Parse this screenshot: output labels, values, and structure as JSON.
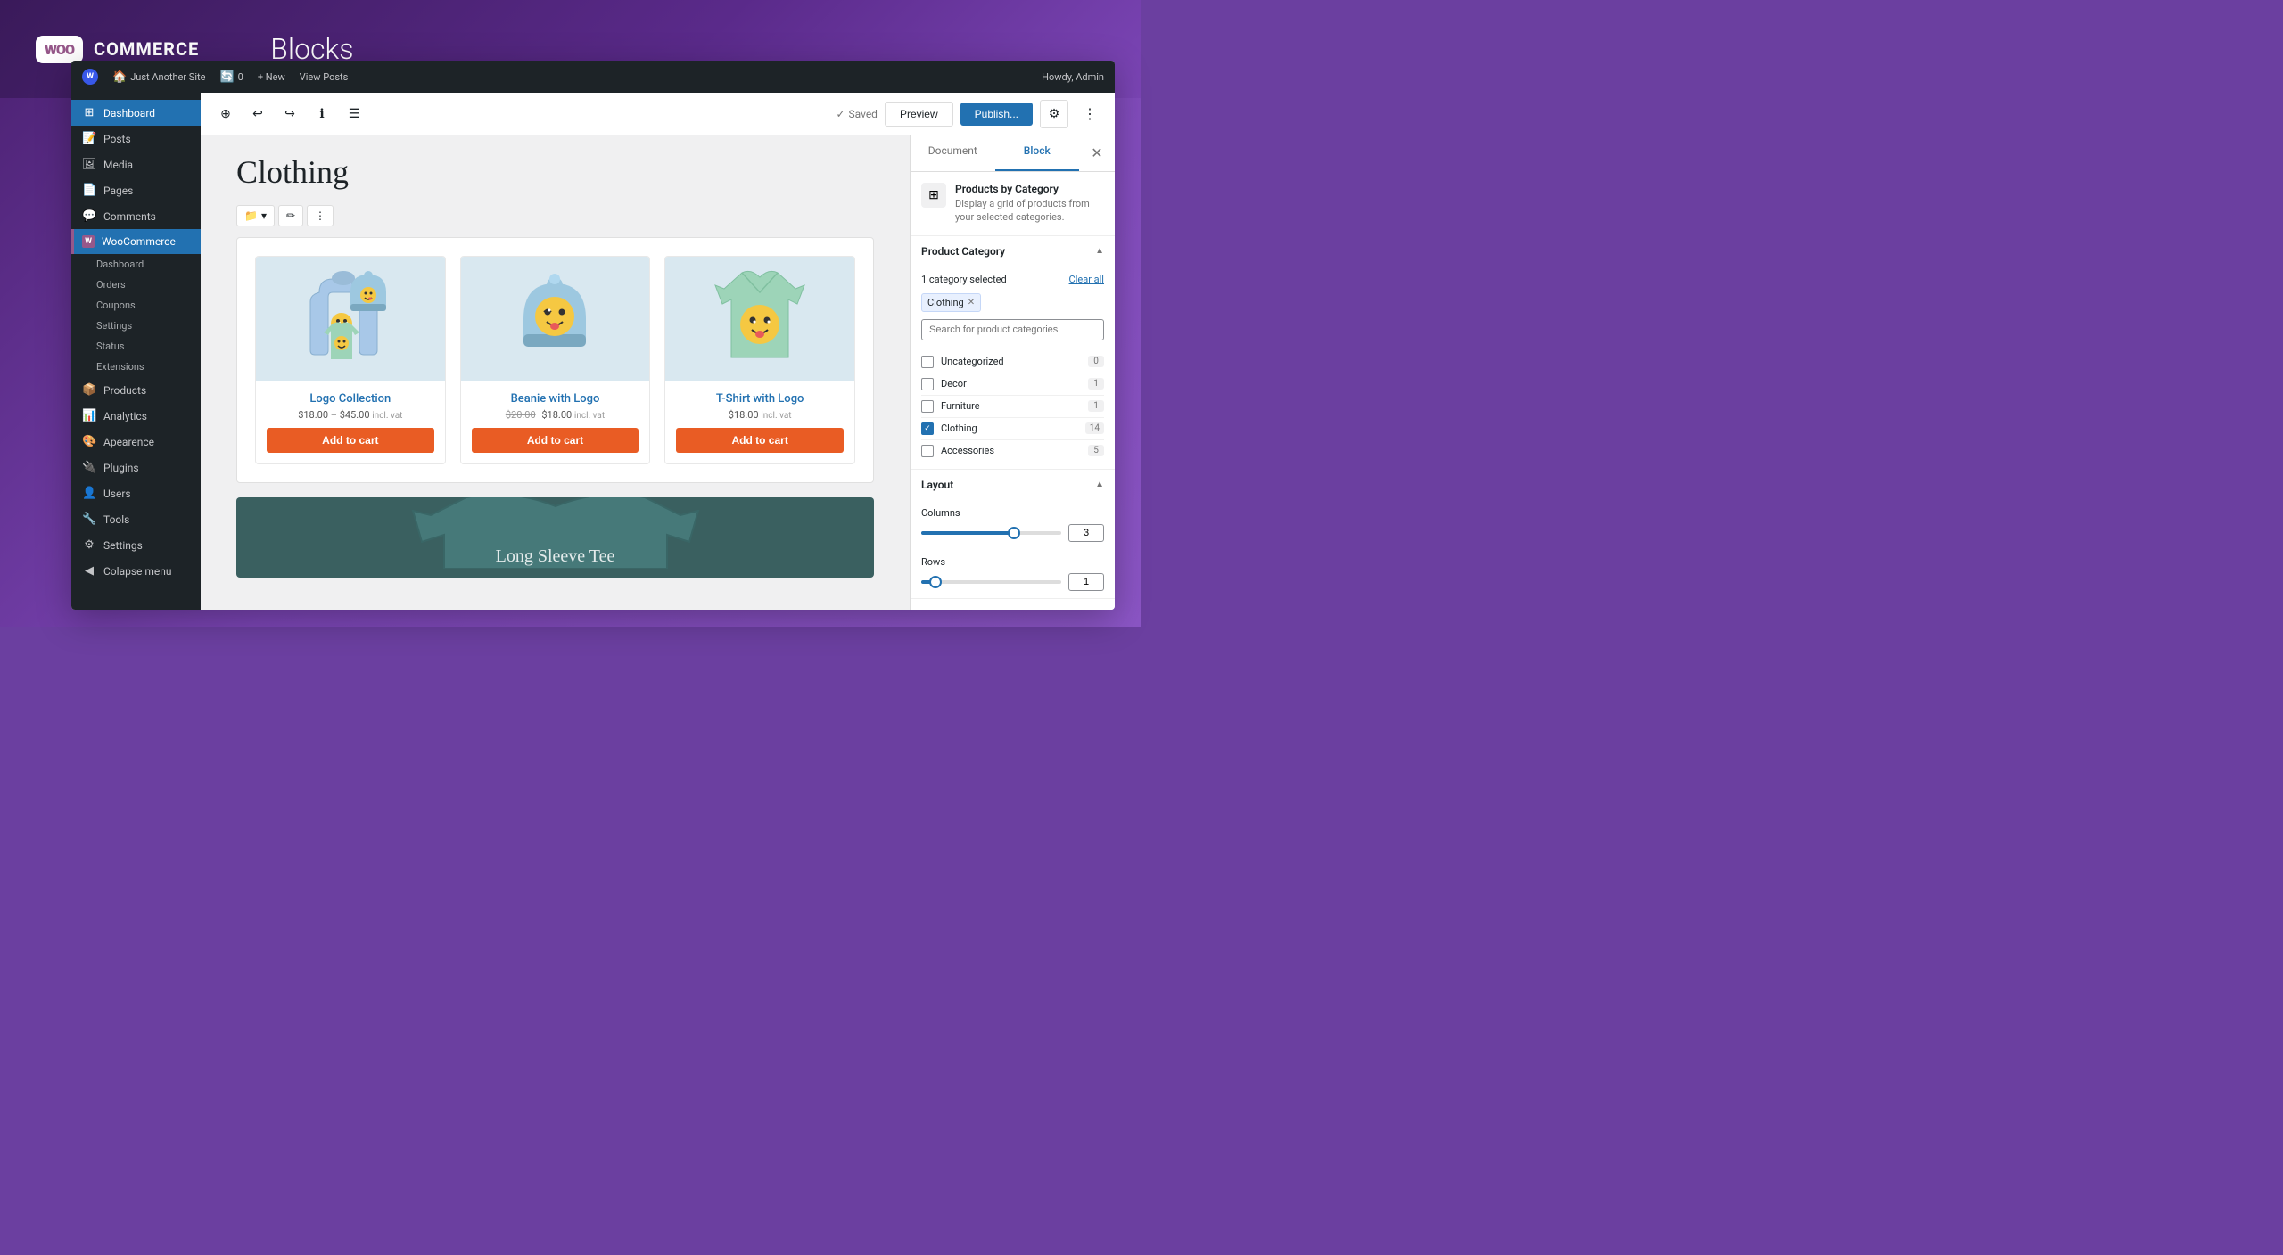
{
  "header": {
    "logo_text": "WOO",
    "logo_emphasis": "COMMERCE",
    "title": "Blocks"
  },
  "admin_bar": {
    "site_name": "Just Another Site",
    "updates_count": "0",
    "new_label": "+ New",
    "view_posts_label": "View Posts",
    "howdy_label": "Howdy, Admin"
  },
  "toolbar": {
    "saved_label": "Saved",
    "preview_label": "Preview",
    "publish_label": "Publish..."
  },
  "sidebar": {
    "items": [
      {
        "label": "Dashboard",
        "icon": "⊞",
        "active": true
      },
      {
        "label": "Posts",
        "icon": "📝",
        "active": false
      },
      {
        "label": "Media",
        "icon": "🖼",
        "active": false
      },
      {
        "label": "Pages",
        "icon": "📄",
        "active": false
      },
      {
        "label": "Comments",
        "icon": "💬",
        "active": false
      },
      {
        "label": "WooCommerce",
        "icon": "W",
        "active": true,
        "woo": true
      },
      {
        "label": "Dashboard",
        "sub": true
      },
      {
        "label": "Orders",
        "sub": true
      },
      {
        "label": "Coupons",
        "sub": true
      },
      {
        "label": "Settings",
        "sub": true
      },
      {
        "label": "Status",
        "sub": true
      },
      {
        "label": "Extensions",
        "sub": true
      },
      {
        "label": "Products",
        "icon": "📦",
        "active": false
      },
      {
        "label": "Analytics",
        "icon": "📊",
        "active": false
      },
      {
        "label": "Appearance",
        "icon": "🎨",
        "active": false
      },
      {
        "label": "Plugins",
        "icon": "🔌",
        "active": false
      },
      {
        "label": "Users",
        "icon": "👤",
        "active": false
      },
      {
        "label": "Tools",
        "icon": "🔧",
        "active": false
      },
      {
        "label": "Settings",
        "icon": "⚙",
        "active": false
      }
    ],
    "collapse_label": "Collapse menu"
  },
  "editor": {
    "page_title": "Clothing",
    "block_toolbar": {
      "folder_btn": "📁",
      "edit_btn": "✏",
      "more_btn": "⋮"
    }
  },
  "products": [
    {
      "name": "Logo Collection",
      "price_from": "$18.00",
      "price_to": "$45.00",
      "price_note": "incl. vat",
      "add_to_cart": "Add to cart"
    },
    {
      "name": "Beanie with Logo",
      "price_original": "$20.00",
      "price_sale": "$18.00",
      "price_note": "incl. vat",
      "add_to_cart": "Add to cart"
    },
    {
      "name": "T-Shirt with Logo",
      "price": "$18.00",
      "price_note": "incl. vat",
      "add_to_cart": "Add to cart"
    }
  ],
  "second_block_preview_label": "Long Sleeve Tee",
  "right_panel": {
    "tab_document": "Document",
    "tab_block": "Block",
    "block_info": {
      "title": "Products by Category",
      "description": "Display a grid of products from your selected categories."
    },
    "product_category_section": {
      "title": "Product Category",
      "selected_count": "1 category selected",
      "clear_label": "Clear all",
      "selected_tag": "Clothing",
      "search_placeholder": "Search for product categories"
    },
    "categories": [
      {
        "name": "Uncategorized",
        "count": "0",
        "checked": false
      },
      {
        "name": "Decor",
        "count": "1",
        "checked": false
      },
      {
        "name": "Furniture",
        "count": "1",
        "checked": false
      },
      {
        "name": "Clothing",
        "count": "14",
        "checked": true
      },
      {
        "name": "Accessories",
        "count": "5",
        "checked": false
      }
    ],
    "layout_section": {
      "title": "Layout",
      "columns_label": "Columns",
      "columns_value": "3",
      "columns_percent": 66,
      "rows_label": "Rows",
      "rows_value": "1",
      "rows_percent": 10
    }
  }
}
